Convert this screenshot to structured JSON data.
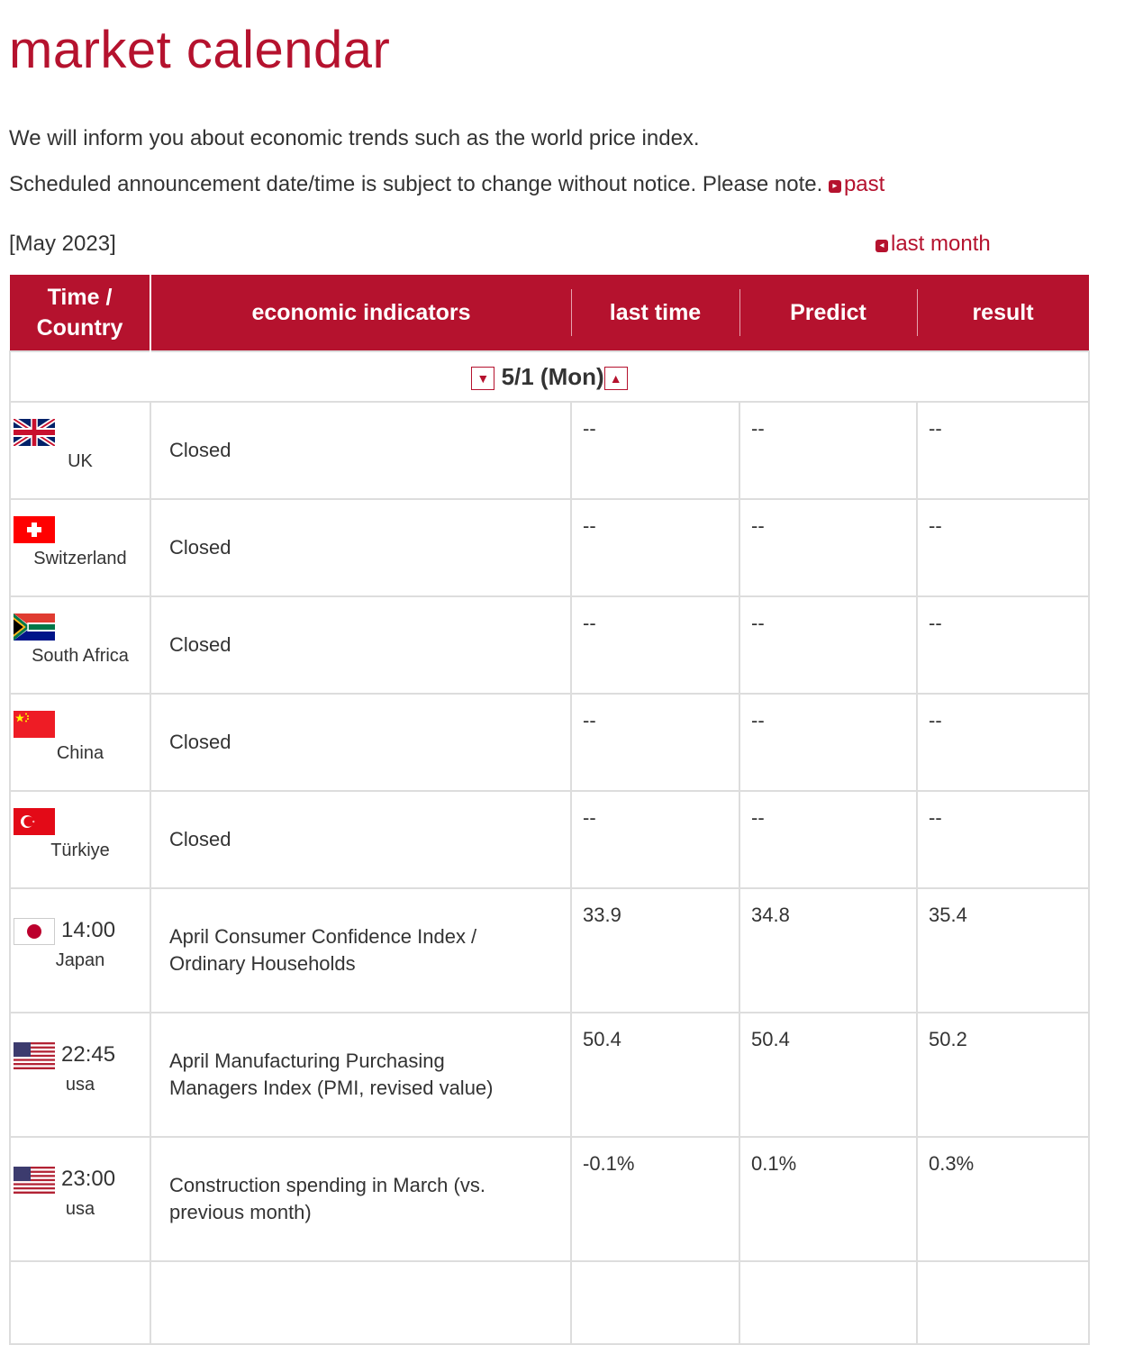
{
  "title": "market calendar",
  "intro": {
    "line1": "We will inform you about economic trends such as the world price index.",
    "line2": "Scheduled announcement date/time is subject to change without notice. Please note.",
    "past_link": "past"
  },
  "month_label": "[May 2023]",
  "last_month_link": "last month",
  "table": {
    "headers": {
      "time_country_1": "Time /",
      "time_country_2": "Country",
      "indicators": "economic indicators",
      "last_time": "last time",
      "predict": "Predict",
      "result": "result"
    },
    "date": "5/1 (Mon)",
    "rows": [
      {
        "time": "",
        "country": "UK",
        "flag": "uk-flag-icon",
        "indicator": "Closed",
        "last": "--",
        "predict": "--",
        "result": "--"
      },
      {
        "time": "",
        "country": "Switzerland",
        "flag": "switzerland-flag-icon",
        "indicator": "Closed",
        "last": "--",
        "predict": "--",
        "result": "--"
      },
      {
        "time": "",
        "country": "South Africa",
        "flag": "south-africa-flag-icon",
        "indicator": "Closed",
        "last": "--",
        "predict": "--",
        "result": "--"
      },
      {
        "time": "",
        "country": "China",
        "flag": "china-flag-icon",
        "indicator": "Closed",
        "last": "--",
        "predict": "--",
        "result": "--"
      },
      {
        "time": "",
        "country": "Türkiye",
        "flag": "turkiye-flag-icon",
        "indicator": "Closed",
        "last": "--",
        "predict": "--",
        "result": "--"
      },
      {
        "time": "14:00",
        "country": "Japan",
        "flag": "japan-flag-icon",
        "indicator_1": "April Consumer Confidence Index /",
        "indicator_2": "Ordinary Households",
        "last": "33.9",
        "predict": "34.8",
        "result": "35.4"
      },
      {
        "time": "22:45",
        "country": "usa",
        "flag": "usa-flag-icon",
        "indicator_1": "April Manufacturing Purchasing",
        "indicator_2": "Managers Index (PMI, revised value)",
        "last": "50.4",
        "predict": "50.4",
        "result": "50.2"
      },
      {
        "time": "23:00",
        "country": "usa",
        "flag": "usa-flag-icon",
        "indicator_1": "Construction spending in March (vs.",
        "indicator_2": "previous month)",
        "last": "-0.1%",
        "predict": "0.1%",
        "result": "0.3%"
      }
    ]
  },
  "colors": {
    "accent": "#b5122e",
    "text": "#333333",
    "border": "#dddddd"
  }
}
